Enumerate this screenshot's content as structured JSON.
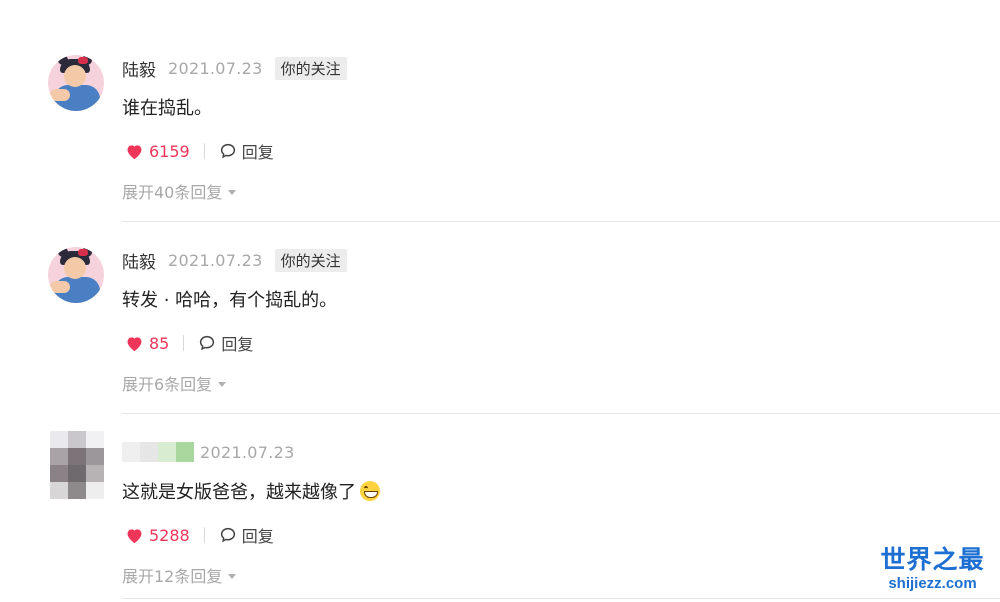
{
  "comments": [
    {
      "username": "陆毅",
      "date": "2021.07.23",
      "badge": "你的关注",
      "text": "谁在捣乱。",
      "likes": "6159",
      "reply_label": "回复",
      "expand_label": "展开40条回复"
    },
    {
      "username": "陆毅",
      "date": "2021.07.23",
      "badge": "你的关注",
      "text": "转发 · 哈哈，有个捣乱的。",
      "likes": "85",
      "reply_label": "回复",
      "expand_label": "展开6条回复"
    },
    {
      "username": "",
      "date": "2021.07.23",
      "text": "这就是女版爸爸，越来越像了",
      "emoji": "grinning-squint-emoji",
      "likes": "5288",
      "reply_label": "回复",
      "expand_label": "展开12条回复"
    }
  ],
  "watermark": {
    "cn": "世界之最",
    "en": "shijiezz.com"
  },
  "colors": {
    "like": "#f0355a",
    "muted": "#a8a8a8",
    "badge_bg": "#ececec",
    "watermark": "#1d6fd1"
  },
  "icons": {
    "like": "heart-icon",
    "reply": "speech-bubble-icon",
    "expand": "caret-down-icon"
  }
}
